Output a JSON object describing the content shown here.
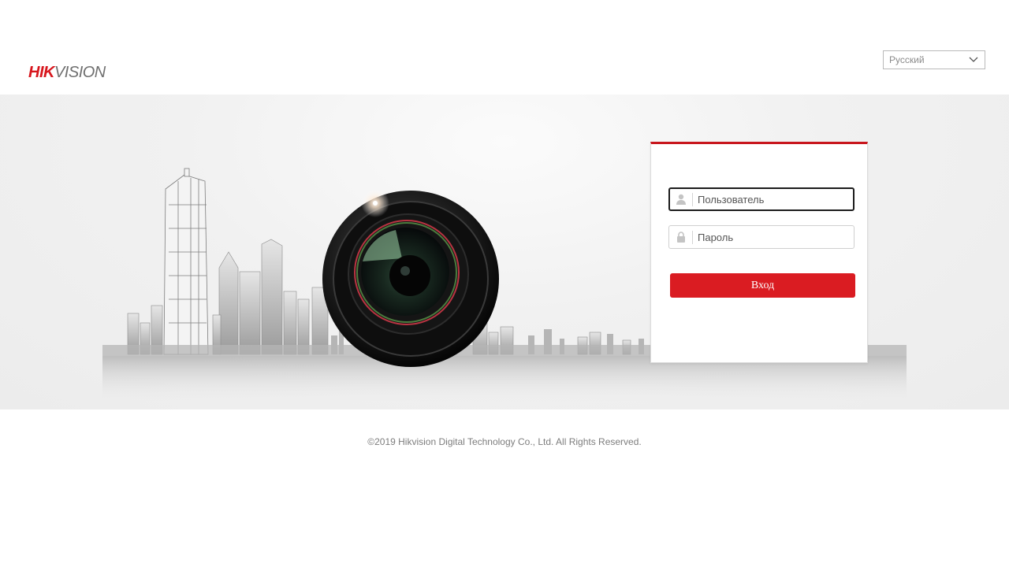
{
  "header": {
    "logo": {
      "part1": "HIK",
      "part2": "VISION"
    },
    "language": {
      "selected": "Русский",
      "icon": "chevron-down-icon"
    }
  },
  "login": {
    "username": {
      "placeholder": "Пользователь",
      "value": "",
      "icon": "user-icon"
    },
    "password": {
      "placeholder": "Пароль",
      "value": "",
      "icon": "lock-icon"
    },
    "submit_label": "Вход"
  },
  "footer": {
    "copyright": "©2019 Hikvision Digital Technology Co., Ltd. All Rights Reserved."
  },
  "colors": {
    "brand_red": "#da1c22",
    "panel_top_border": "#c8161d",
    "logo_gray": "#6f6f6f"
  }
}
